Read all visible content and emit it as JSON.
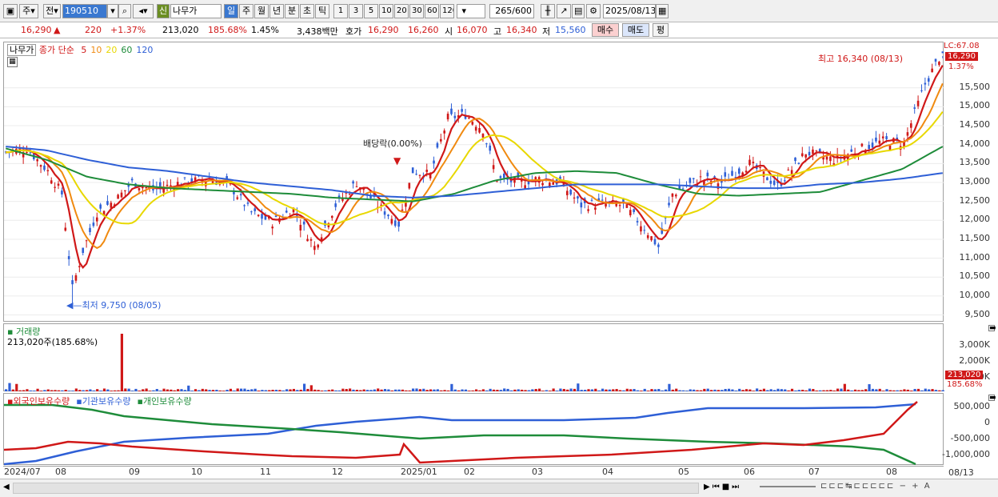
{
  "toolbar": {
    "market": "주",
    "prefix": "전",
    "code": "190510",
    "name_badge": "신",
    "name": "나무가",
    "periods": [
      "일",
      "주",
      "월",
      "년",
      "분",
      "초",
      "틱"
    ],
    "nums": [
      "1",
      "3",
      "5",
      "10",
      "20",
      "30",
      "60",
      "120"
    ],
    "count": "265",
    "count_total": "/600",
    "date": "2025/08/13"
  },
  "quote": {
    "price": "16,290",
    "arrow": "▲",
    "change": "220",
    "pct": "+1.37%",
    "volume": "213,020",
    "vol_pct": "185.68%",
    "turnover": "1.45%",
    "amount": "3,438백만",
    "hoga_label": "호가",
    "hoga_ask": "16,290",
    "hoga_bid": "16,260",
    "open_label": "시",
    "open": "16,070",
    "high_label": "고",
    "high": "16,340",
    "low_label": "저",
    "low": "15,560",
    "buy": "매수",
    "sell": "매도",
    "avg": "평"
  },
  "price_panel": {
    "name": "나무가",
    "ma_label": "종가 단순",
    "ma": [
      {
        "label": "5",
        "color": "#d01818"
      },
      {
        "label": "10",
        "color": "#f08a10"
      },
      {
        "label": "20",
        "color": "#e8d800"
      },
      {
        "label": "60",
        "color": "#1e8c3a"
      },
      {
        "label": "120",
        "color": "#2e5fd6"
      }
    ],
    "lc": "LC:67.08",
    "cur_price": "16,290",
    "cur_pct": "1.37%",
    "high_annot": "최고 16,340 (08/13)",
    "low_annot": "최저 9,750 (08/05)",
    "div_annot": "배당락(0.00%)",
    "yticks": [
      "15,500",
      "15,000",
      "14,500",
      "14,000",
      "13,500",
      "13,000",
      "12,500",
      "12,000",
      "11,500",
      "11,000",
      "10,500",
      "10,000",
      "9,500"
    ]
  },
  "volume_panel": {
    "title": "거래량",
    "value": "213,020주(185.68%)",
    "yticks": [
      "3,000K",
      "2,000K",
      "1,000K"
    ],
    "cur": "213,020",
    "cur_pct": "185.68%"
  },
  "holder_panel": {
    "legend": [
      {
        "label": "외국인보유수량",
        "color": "#d01818"
      },
      {
        "label": "기관보유수량",
        "color": "#2e5fd6"
      },
      {
        "label": "개인보유수량",
        "color": "#1e8c3a"
      }
    ],
    "yticks": [
      "500,000",
      "0",
      "-500,000",
      "-1,000,000"
    ]
  },
  "xaxis": {
    "labels": [
      "2024/07",
      "08",
      "09",
      "10",
      "11",
      "12",
      "2025/01",
      "02",
      "03",
      "04",
      "05",
      "06",
      "07",
      "08"
    ],
    "end": "08/13"
  },
  "chart_data": {
    "type": "candlestick",
    "ylim": [
      9300,
      16700
    ],
    "start": "2024/07",
    "end": "2025/08/13",
    "ma_120": [
      13950,
      13850,
      13600,
      13400,
      13300,
      13150,
      13000,
      12900,
      12800,
      12650,
      12600,
      12650,
      12750,
      12850,
      12950,
      12950,
      12950,
      12900,
      12850,
      12850,
      12950,
      13000,
      13100,
      13250
    ],
    "ma_60": [
      13900,
      13600,
      13150,
      12950,
      12850,
      12800,
      12750,
      12700,
      12600,
      12550,
      12500,
      12700,
      13050,
      13250,
      13300,
      13250,
      12950,
      12700,
      12650,
      12700,
      12750,
      13050,
      13350,
      13950
    ],
    "highs": {
      "max": 16340,
      "max_date": "08/13",
      "min": 9750,
      "min_date": "08/05"
    }
  }
}
